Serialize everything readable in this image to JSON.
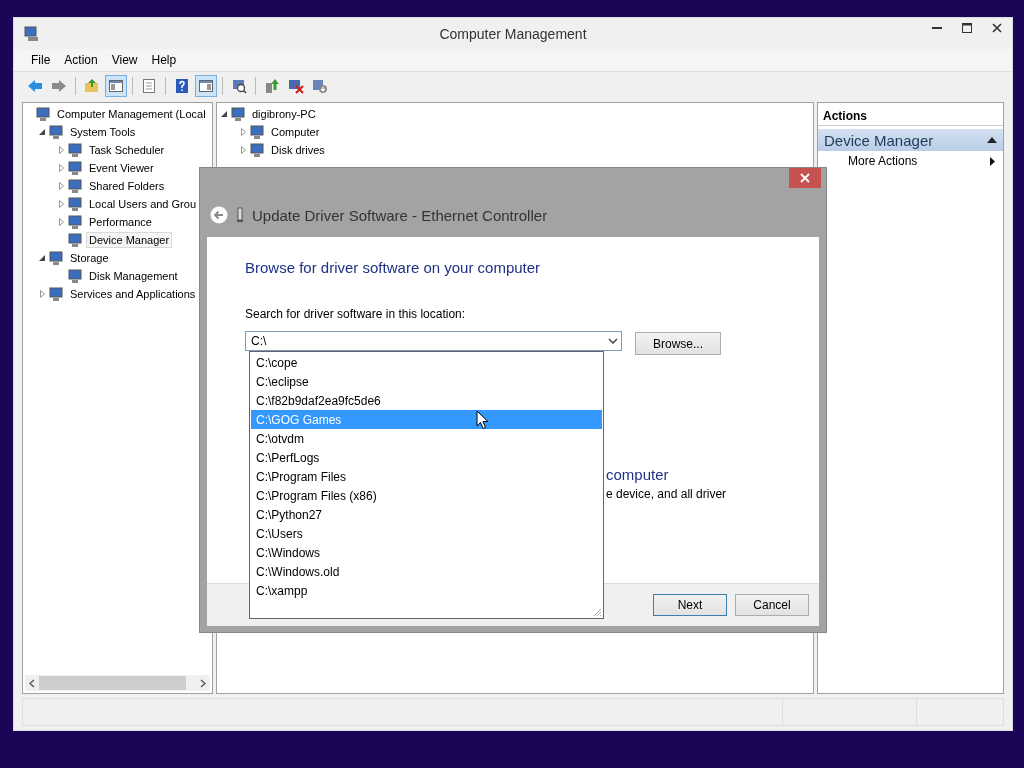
{
  "window": {
    "title": "Computer Management"
  },
  "menu": [
    "File",
    "Action",
    "View",
    "Help"
  ],
  "toolbar": [
    [
      {
        "pressed": false
      },
      {
        "pressed": false
      }
    ],
    [
      {
        "pressed": false
      },
      {
        "pressed": true
      }
    ],
    [
      {
        "pressed": false
      }
    ],
    [
      {
        "pressed": false
      },
      {
        "pressed": true
      }
    ],
    [
      {
        "pressed": false
      }
    ],
    [
      {
        "pressed": false
      },
      {
        "pressed": false
      },
      {
        "pressed": false
      }
    ]
  ],
  "navigation_tree": [
    {
      "label": "Computer Management (Local",
      "selected": false,
      "children": [
        {
          "label": "System Tools",
          "expanded": true,
          "selected": false,
          "children": [
            {
              "label": "Task Scheduler",
              "expanded": false,
              "selected": false
            },
            {
              "label": "Event Viewer",
              "expanded": false,
              "selected": false
            },
            {
              "label": "Shared Folders",
              "expanded": false,
              "selected": false
            },
            {
              "label": "Local Users and Grou",
              "expanded": false,
              "selected": false
            },
            {
              "label": "Performance",
              "expanded": false,
              "selected": false
            },
            {
              "label": "Device Manager",
              "selected": true
            }
          ]
        },
        {
          "label": "Storage",
          "expanded": true,
          "selected": false,
          "children": [
            {
              "label": "Disk Management",
              "selected": false
            }
          ]
        },
        {
          "label": "Services and Applications",
          "expanded": false,
          "selected": false
        }
      ]
    }
  ],
  "device_tree": [
    {
      "label": "digibrony-PC",
      "expanded": true,
      "children": [
        {
          "label": "Computer",
          "expanded": false
        },
        {
          "label": "Disk drives",
          "expanded": false
        }
      ]
    }
  ],
  "actions": {
    "title": "Actions",
    "section": "Device Manager",
    "items": [
      "More Actions"
    ]
  },
  "dialog": {
    "title": "Update Driver Software - Ethernet Controller",
    "heading": "Browse for driver software on your computer",
    "location_label": "Search for driver software in this location:",
    "location_value": "C:\\",
    "browse": "Browse...",
    "options": [
      {
        "label": "C:\\cope",
        "selected": false
      },
      {
        "label": "C:\\eclipse",
        "selected": false
      },
      {
        "label": "C:\\f82b9daf2ea9fc5de6",
        "selected": false
      },
      {
        "label": "C:\\GOG Games",
        "selected": true
      },
      {
        "label": "C:\\otvdm",
        "selected": false
      },
      {
        "label": "C:\\PerfLogs",
        "selected": false
      },
      {
        "label": "C:\\Program Files",
        "selected": false
      },
      {
        "label": "C:\\Program Files (x86)",
        "selected": false
      },
      {
        "label": "C:\\Python27",
        "selected": false
      },
      {
        "label": "C:\\Users",
        "selected": false
      },
      {
        "label": "C:\\Windows",
        "selected": false
      },
      {
        "label": "C:\\Windows.old",
        "selected": false
      },
      {
        "label": "C:\\xampp",
        "selected": false
      }
    ],
    "partial_heading": "computer",
    "partial_text": "e device, and all driver",
    "buttons": [
      "Next",
      "Cancel"
    ]
  }
}
